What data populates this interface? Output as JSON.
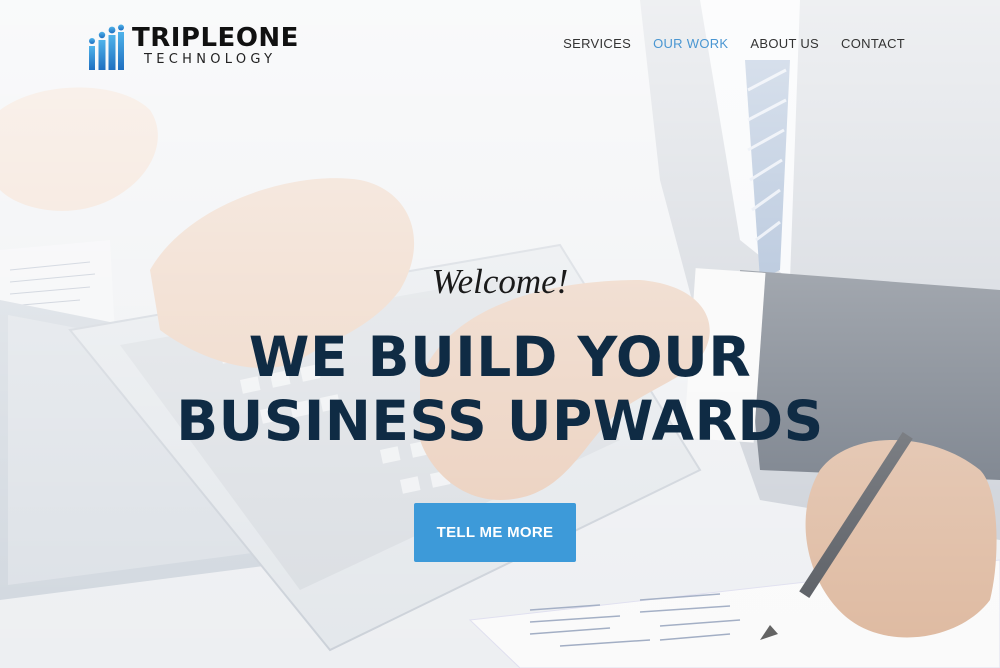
{
  "brand": {
    "name": "TRIPLEONE",
    "subtitle": "TECHNOLOGY",
    "logo_icon": "bar-people-icon",
    "accent_color": "#3d9ad9"
  },
  "nav": {
    "items": [
      {
        "label": "SERVICES",
        "active": false
      },
      {
        "label": "OUR WORK",
        "active": true
      },
      {
        "label": "ABOUT US",
        "active": false
      },
      {
        "label": "CONTACT",
        "active": false
      }
    ],
    "active_color": "#4a96d2"
  },
  "hero": {
    "welcome": "Welcome!",
    "headline": "WE BUILD YOUR BUSINESS UPWARDS",
    "cta_label": "TELL ME MORE",
    "headline_color": "#0f2b44"
  }
}
